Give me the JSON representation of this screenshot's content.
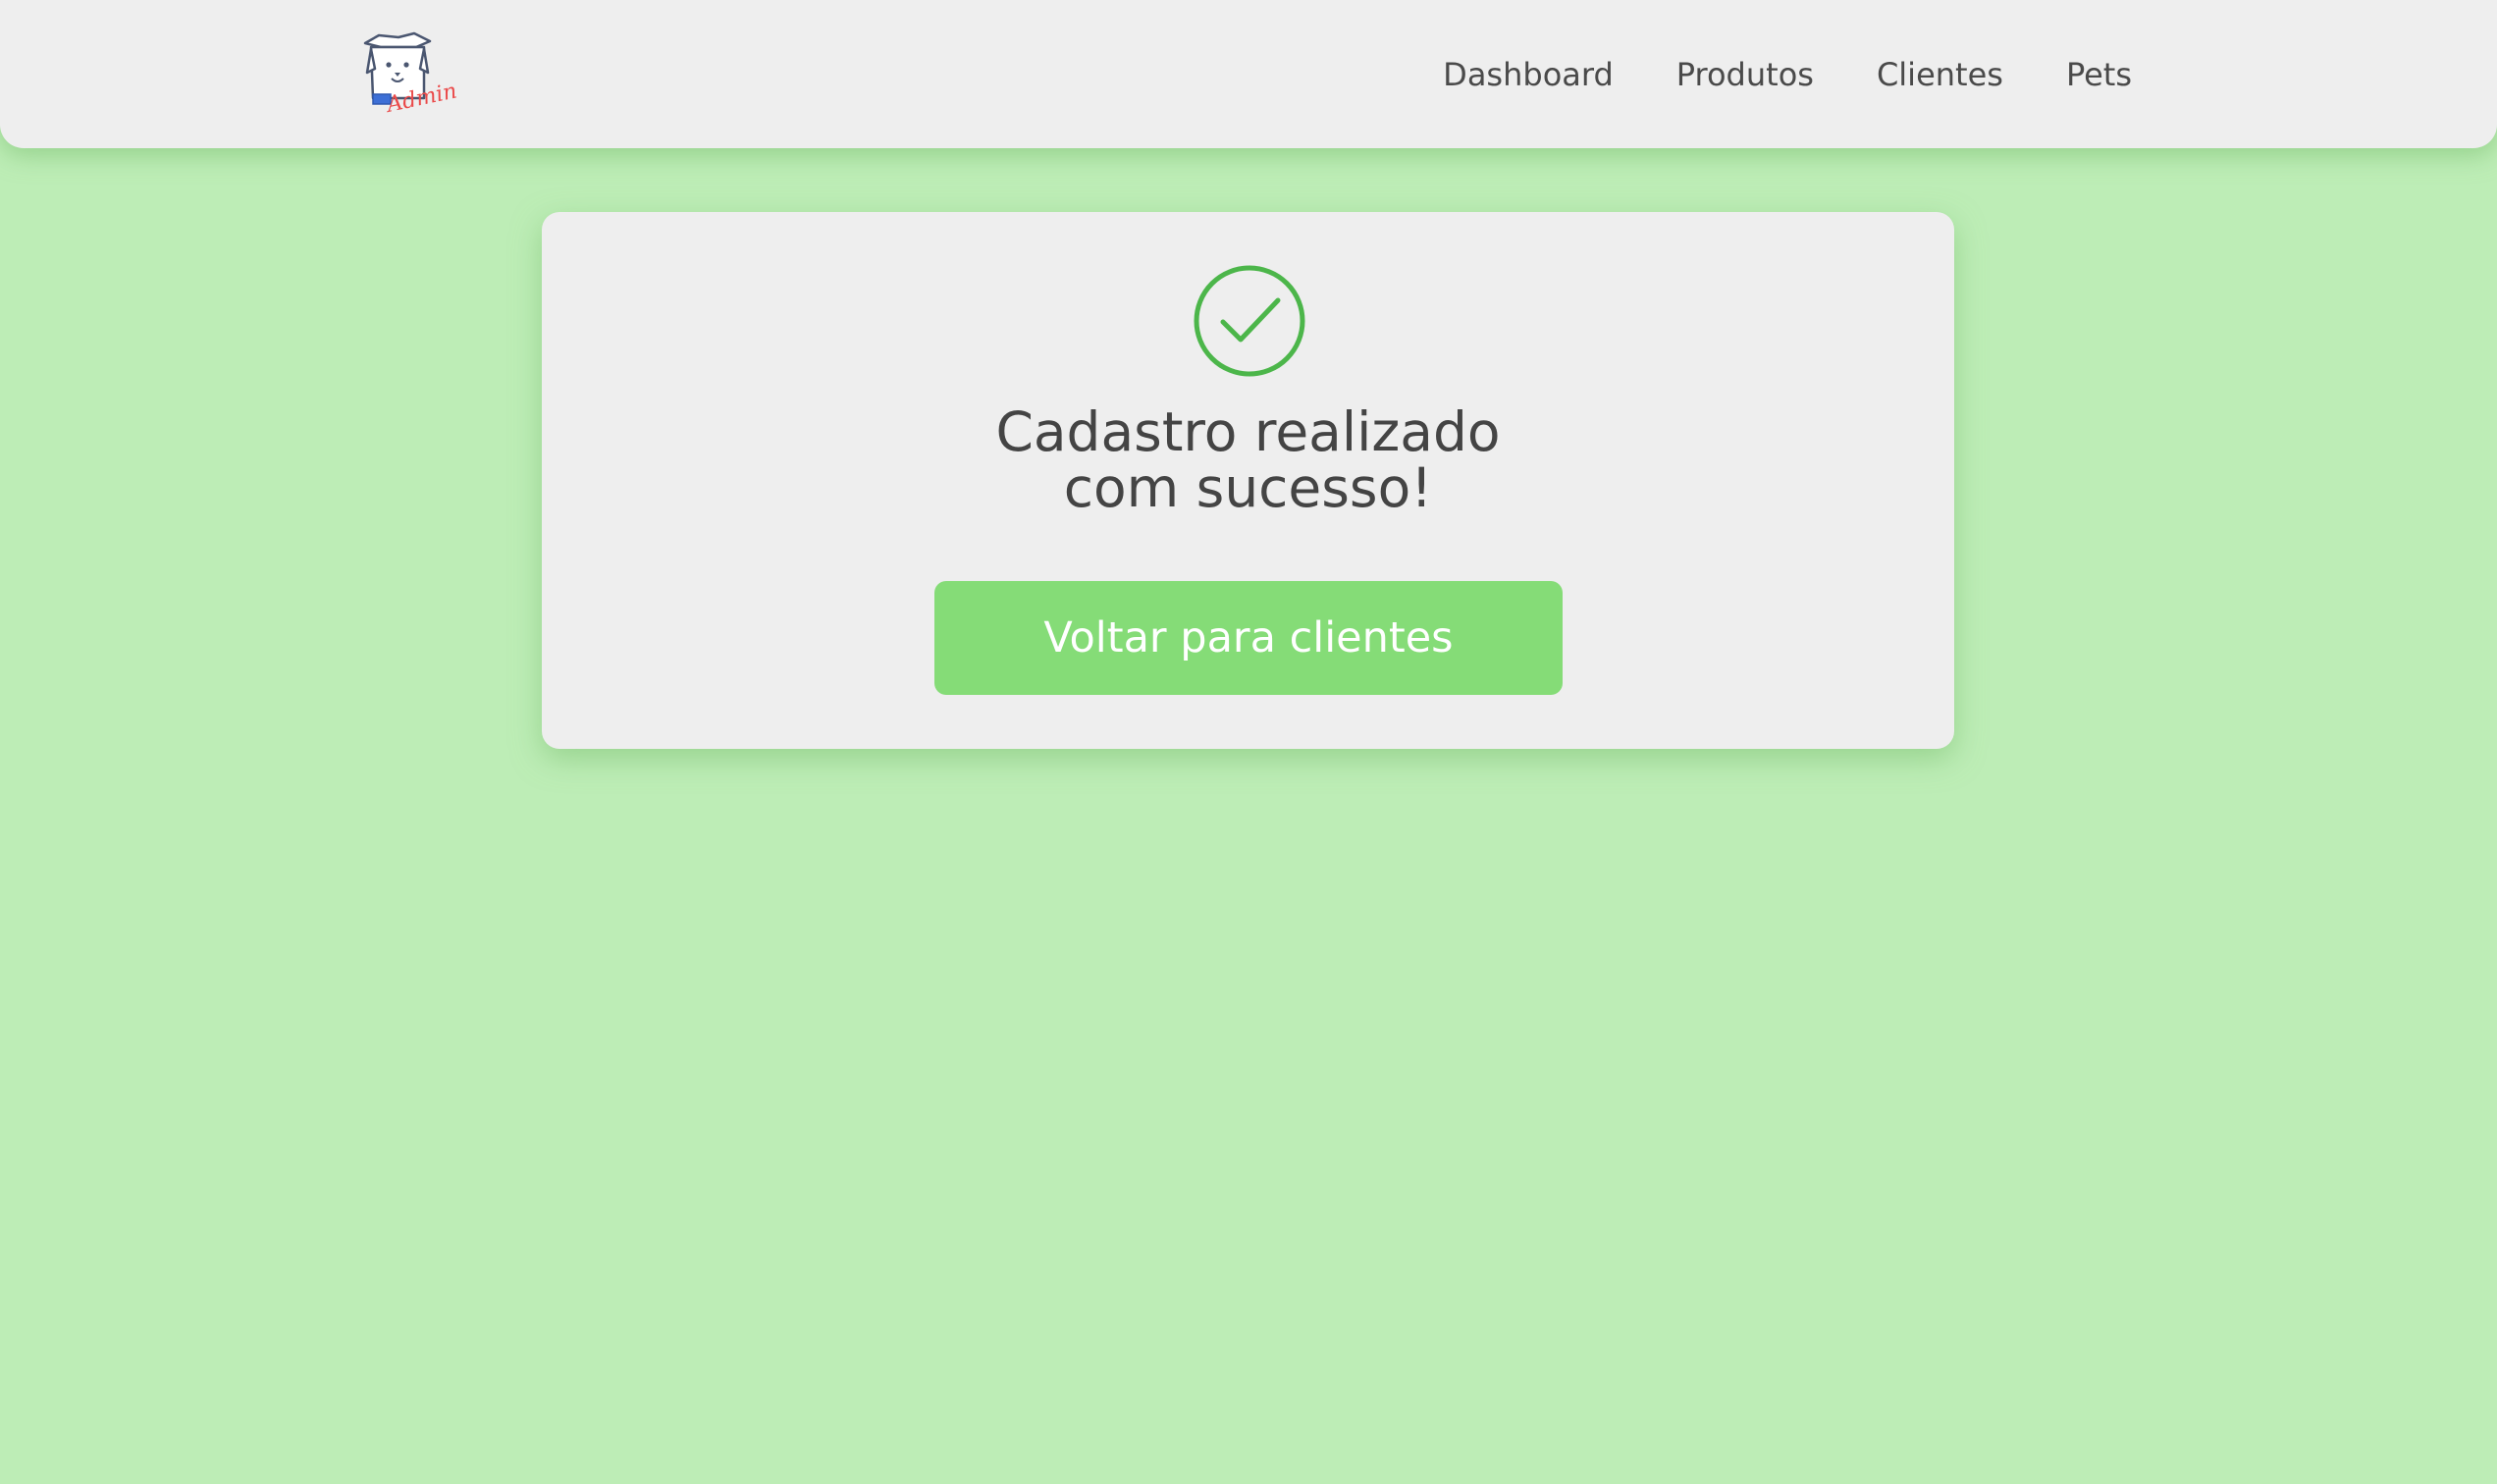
{
  "header": {
    "logo_icon": "dog-admin-logo-icon",
    "logo_text": "Admin",
    "nav": [
      {
        "label": "Dashboard"
      },
      {
        "label": "Produtos"
      },
      {
        "label": "Clientes"
      },
      {
        "label": "Pets"
      }
    ]
  },
  "card": {
    "icon": "check-circle-icon",
    "title_line1": "Cadastro realizado",
    "title_line2": "com sucesso!",
    "button_label": "Voltar para clientes"
  },
  "colors": {
    "background": "#bdedb6",
    "surface": "#eeeeee",
    "accent": "#85dc77",
    "success": "#4cb64a",
    "text": "#4a4a4a"
  }
}
